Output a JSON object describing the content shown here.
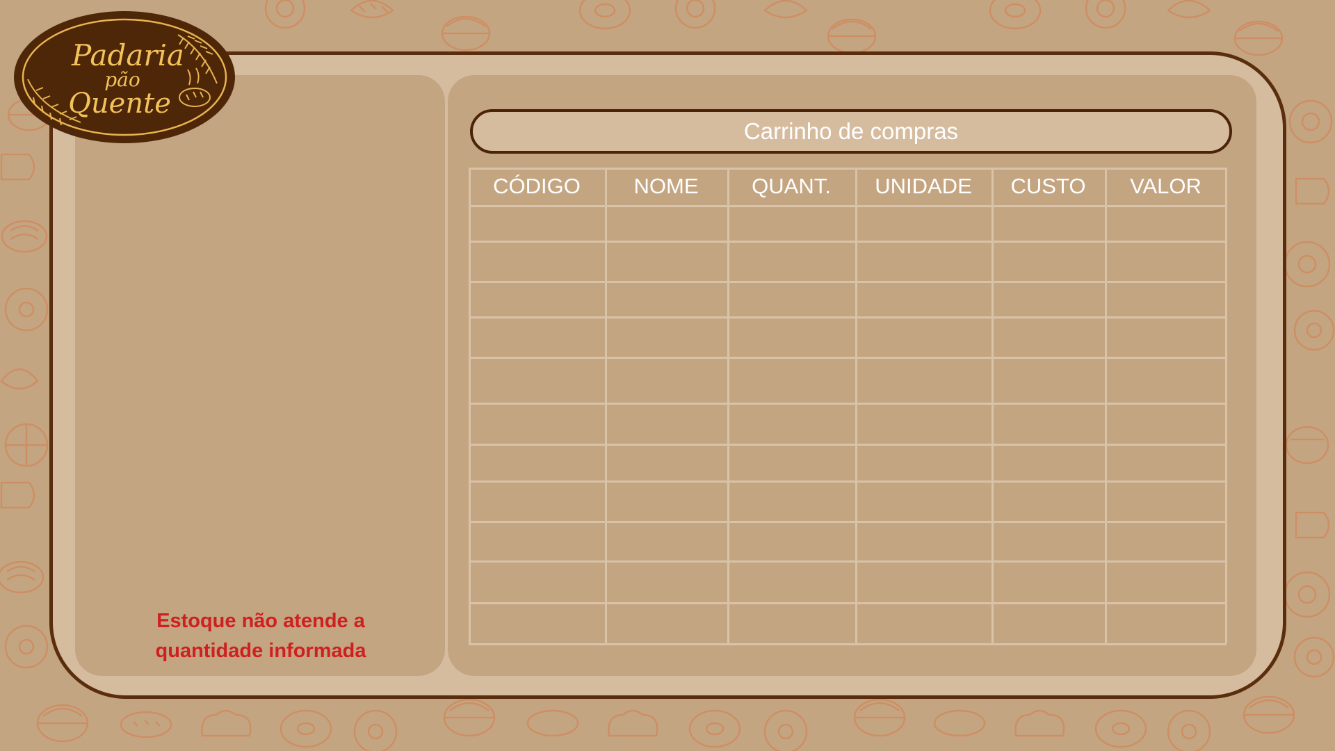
{
  "logo": {
    "line1": "Padaria",
    "line2": "pão",
    "line3": "Quente"
  },
  "cart": {
    "title": "Carrinho de compras",
    "columns": [
      "CÓDIGO",
      "NOME",
      "QUANT.",
      "UNIDADE",
      "CUSTO",
      "VALOR"
    ],
    "rows": []
  },
  "stock_message": {
    "line1": "Estoque não atende a",
    "line2": "quantidade informada"
  },
  "colors": {
    "background": "#c4a582",
    "frame": "#d6bc9f",
    "border": "#5a2d0c",
    "logo_bg": "#4e2608",
    "logo_text": "#f3c25a",
    "error_text": "#cf2020"
  }
}
